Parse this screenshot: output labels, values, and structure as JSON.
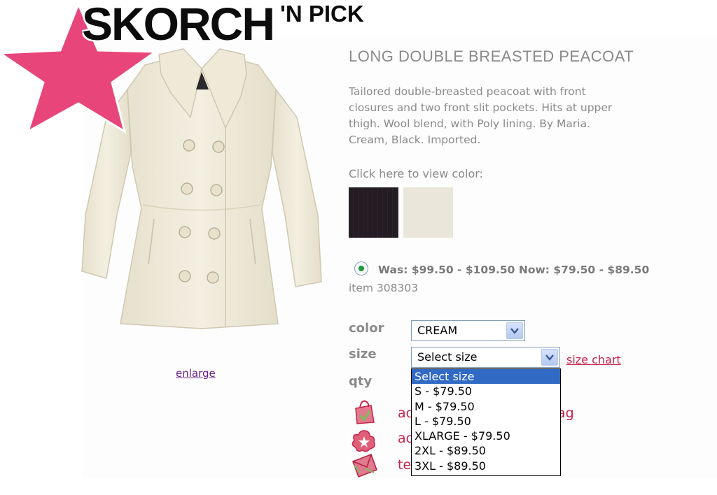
{
  "logo": {
    "main": "SKORCH",
    "sub": "'N PICK"
  },
  "product": {
    "title": "LONG DOUBLE BREASTED PEACOAT",
    "description": "Tailored double-breasted peacoat with front\nclosures and two front slit pockets. Hits at upper\nthigh. Wool blend, with Poly lining. By Maria.\nCream, Black. Imported.",
    "color_hint": "Click here to view color:",
    "swatches": [
      {
        "name": "Black",
        "color": "#241d23"
      },
      {
        "name": "Cream",
        "color": "#ebe6da"
      }
    ],
    "price": "Was: $99.50 - $109.50 Now: $79.50 - $89.50",
    "item": "item 308303",
    "enlarge": "enlarge"
  },
  "form": {
    "color_label": "color",
    "size_label": "size",
    "qty_label": "qty",
    "color_value": "CREAM",
    "size_value": "Select size",
    "size_chart": "size chart",
    "size_options": [
      "Select size",
      "S - $79.50",
      "M - $79.50",
      "L - $79.50",
      "XLARGE - $79.50",
      "2XL - $89.50",
      "3XL - $89.50"
    ]
  },
  "actions": {
    "row1_left": "ad",
    "row1_right": "ag",
    "row2_left": "ad",
    "row3_left": "te"
  },
  "colors": {
    "accent": "#c8234a",
    "star": "#e8457a",
    "link_visited": "#6a1f8a",
    "list_highlight": "#316ac5"
  }
}
